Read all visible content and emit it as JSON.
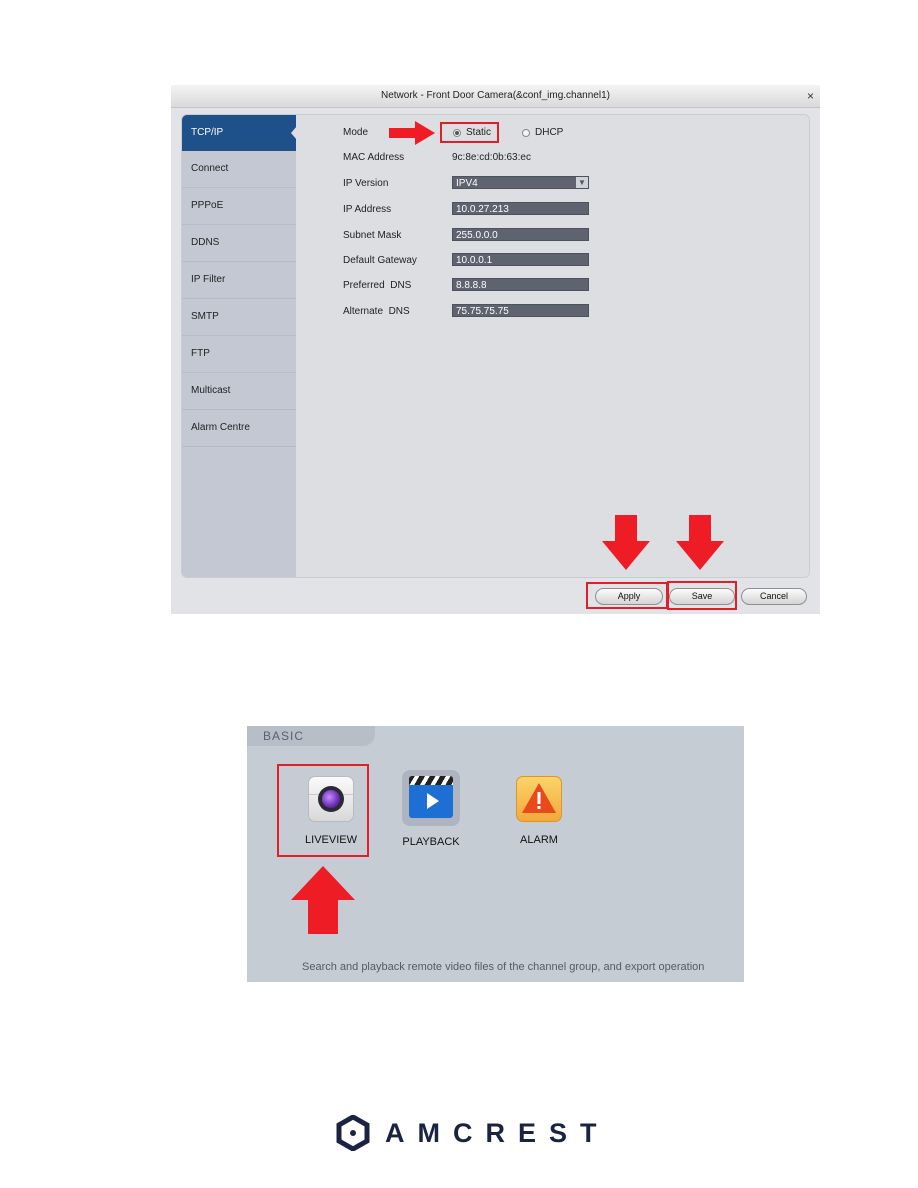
{
  "dialog": {
    "title": "Network - Front Door Camera(&conf_img.channel1)",
    "close_glyph": "×",
    "sidebar": {
      "items": [
        {
          "label": "TCP/IP",
          "active": true
        },
        {
          "label": "Connect"
        },
        {
          "label": "PPPoE"
        },
        {
          "label": "DDNS"
        },
        {
          "label": "IP Filter"
        },
        {
          "label": "SMTP"
        },
        {
          "label": "FTP"
        },
        {
          "label": "Multicast"
        },
        {
          "label": "Alarm Centre"
        }
      ]
    },
    "form": {
      "mode_label": "Mode",
      "mode_options": [
        {
          "label": "Static",
          "selected": true
        },
        {
          "label": "DHCP",
          "selected": false
        }
      ],
      "mac_label": "MAC Address",
      "mac_value": "9c:8e:cd:0b:63:ec",
      "ip_version_label": "IP Version",
      "ip_version_value": "IPV4",
      "dropdown_glyph": "▼",
      "ip_address_label": "IP Address",
      "ip_address_value": "10.0.27.213",
      "subnet_label": "Subnet Mask",
      "subnet_value": "255.0.0.0",
      "gateway_label": "Default Gateway",
      "gateway_value": "10.0.0.1",
      "pref_dns_label": "Preferred  DNS",
      "pref_dns_value": "8.8.8.8",
      "alt_dns_label": "Alternate  DNS",
      "alt_dns_value": "75.75.75.75"
    },
    "buttons": {
      "apply": "Apply",
      "save": "Save",
      "cancel": "Cancel"
    }
  },
  "basic_panel": {
    "tab_label": "BASIC",
    "apps": [
      {
        "label": "LIVEVIEW",
        "icon": "camera-lens-icon"
      },
      {
        "label": "PLAYBACK",
        "icon": "clapperboard-play-icon"
      },
      {
        "label": "ALARM",
        "icon": "warning-triangle-icon"
      }
    ],
    "description": "Search and playback remote video files of the channel group, and export operation"
  },
  "annotations": {
    "highlight_color": "#e02028",
    "arrow_color": "#ee1c24"
  },
  "footer": {
    "brand": "AMCREST"
  }
}
